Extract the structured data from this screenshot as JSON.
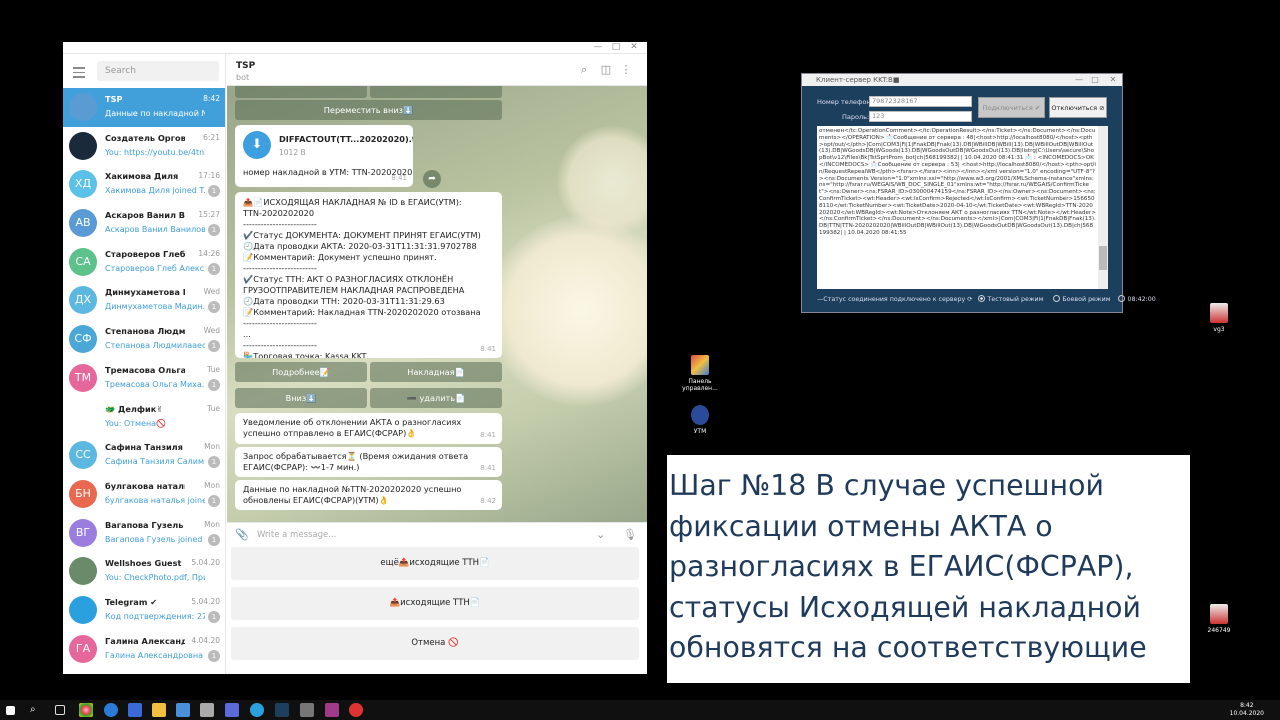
{
  "telegram": {
    "search_placeholder": "Search",
    "chats": [
      {
        "name": "TSP",
        "time": "8:42",
        "preview": "Данные по накладной №TTN-20...",
        "initials": "",
        "color": "#5a9bd4",
        "unread": ""
      },
      {
        "name": "Создатель Оргов",
        "time": "6:21",
        "preview": "You: https://youtu.be/4tnEC...",
        "initials": "",
        "color": "#1a2a3a",
        "unread": ""
      },
      {
        "name": "Хакимова Диля",
        "time": "17:16",
        "preview": "Хакимова Диля joined T...",
        "initials": "ХД",
        "color": "#5cc1e8",
        "unread": "1"
      },
      {
        "name": "Аскаров Ванил Вани...",
        "time": "15:27",
        "preview": "Аскаров Ванил Ванилов...",
        "initials": "АВ",
        "color": "#5b9bd5",
        "unread": "1"
      },
      {
        "name": "Староверов Глеб Ал...",
        "time": "14:26",
        "preview": "Староверов Глеб Алекс...",
        "initials": "СА",
        "color": "#5cc18a",
        "unread": "1"
      },
      {
        "name": "Динмухаметова Мад...",
        "time": "Wed",
        "preview": "Динмухаметова Мадин...",
        "initials": "ДХ",
        "color": "#5cb8e0",
        "unread": "1"
      },
      {
        "name": "Степанова Людмила...",
        "time": "Wed",
        "preview": "Степанова Людмилааес...",
        "initials": "СФ",
        "color": "#4aa8d8",
        "unread": "1"
      },
      {
        "name": "Тремасова Ольга Мих...",
        "time": "Tue",
        "preview": "Тремасова Ольга Миха...",
        "initials": "ТМ",
        "color": "#e6679a",
        "unread": "1"
      },
      {
        "name": "🐲 Делфик✌",
        "time": "Tue",
        "preview": "You: Отмена🚫",
        "initials": "",
        "color": "#ffffff",
        "unread": ""
      },
      {
        "name": "Сафина Танзиля Сали...",
        "time": "Mon",
        "preview": "Сафина Танзиля Салим...",
        "initials": "СС",
        "color": "#5cb8e0",
        "unread": "1"
      },
      {
        "name": "булгакова наталья",
        "time": "Mon",
        "preview": "булгакова наталья joine...",
        "initials": "БН",
        "color": "#e8694f",
        "unread": "1"
      },
      {
        "name": "Вагапова Гузель",
        "time": "Mon",
        "preview": "Вагапова Гузель joined ...",
        "initials": "ВГ",
        "color": "#9b7de0",
        "unread": "1"
      },
      {
        "name": "Wellshoes Guest",
        "time": "5.04.20",
        "preview": "You: CheckPhoto.pdf, Прим...",
        "initials": "",
        "color": "#6a8a6a",
        "unread": ""
      },
      {
        "name": "Telegram ✔",
        "time": "5.04.20",
        "preview": "Код подтверждения: 27...",
        "initials": "",
        "color": "#2aa1de",
        "unread": "1"
      },
      {
        "name": "Галина Александро...",
        "time": "4.04.20",
        "preview": "Галина Александровна j...",
        "initials": "ГА",
        "color": "#e6679a",
        "unread": "1"
      }
    ],
    "header": {
      "title": "TSP",
      "subtitle": "bot"
    },
    "kb_top": "Переместить вниз⬇️",
    "file": {
      "name": "DIFFACTOUT(TT...20202020).txt",
      "size": "1012 B",
      "caption": "номер накладной в УТМ: TTN-2020202020",
      "time": "8:41"
    },
    "big_msg": {
      "lines": [
        "📤📄ИСХОДЯЩАЯ НАКЛАДНАЯ № ID в ЕГАИС(УТМ):",
        "TTN-2020202020",
        "-------------------------",
        "✔️Статус ДОКУМЕНТА: ДОКУМЕНТ ПРИНЯТ ЕГАИС(УТМ)",
        "🕘Дата проводки АКТА: 2020-03-31T11:31:31.9702788",
        "📝Комментарий: Документ успешно принят.",
        "-------------------------",
        "✔️Статус ТТН: АКТ О РАЗНОГЛАСИЯХ ОТКЛОНЁН",
        "ГРУЗООТПРАВИТЕЛЕМ НАКЛАДНАЯ РАСПРОВЕДЕНА",
        "🕘Дата проводки ТТН: 2020-03-31T11:31:29.63",
        "📝Комментарий: Накладная TTN-2020202020 отозвана",
        "-------------------------",
        "...",
        "-------------------------",
        "🏪Торговая точка: Kassa KKT"
      ],
      "time": "8:41"
    },
    "kb_buttons": [
      "Подробнее📝",
      "Накладная📄",
      "Вниз⬇️",
      "➖ удалить📄"
    ],
    "msg_uved": {
      "text": "Уведомление об отклонении АКТА о разногласиях успешно отправлено в ЕГАИС(ФСРАР)👌",
      "time": "8:41"
    },
    "msg_zapros": {
      "text": "Запрос обрабатывается⏳ (Время ожидания ответа ЕГАИС(ФСРАР): 〰️1-7 мин.)",
      "time": "8:41"
    },
    "msg_dannye": {
      "text": "Данные по накладной №TTN-2020202020 успешно обновлены ЕГАИС(ФСРАР)(УТМ)👌",
      "time": "8:42"
    },
    "composer_placeholder": "Write a message...",
    "bot_buttons": [
      "ещё📤исходящие ТТН📄",
      "📤исходящие ТТН📄",
      "Отмена 🚫"
    ]
  },
  "client_server": {
    "title": "Клиент-сервер КKT:В■",
    "phone_label": "Номер телефона:",
    "phone_value": "79872328167",
    "password_label": "Пароль:",
    "password_value": "123",
    "connect_btn": "Подключиться ✔",
    "disconnect_btn": "Отключиться ⊘",
    "log": "отменен</tc:OperationComment></tc:OperationResult></ns:Ticket></ns:Document></ns:Documents></OPERATION> 📩Сообщение от сервера : 48|<host>http://localhost8080/</host><pth>opt/out/</pth>|Com|COM3|Fi|1|FnakDB|Fnak(13).DB|WBillDB|WBill(13).DB|WBillOutDB|WBillOut(13).DB|WGoodsDB|WGoods(13).DB|WGoodsOutDB|WGoodsOut(13).DB|listrg|C:\\Users\\secure\\ShopBot\\v12\\Files\\Bk|TstSprtProm_bot|ch|568199382| | 10.04.2020 08:41:31 📩 : <INCOMEDOCS>OK</INCOMEDOCS> 📩Сообщение от сервера : 53| <host>http://localhost8080/</host><pth>opt/in/RequestRepealWB</pth><fsrar></fsrar><inn></inn></xml version=\"1.0\" encoding=\"UTF-8\"?><ns:Documents Version=\"1.0\"xmlns:xsi=\"http://www.w3.org/2001/XMLSchema-instance\"xmlns:ns=\"http://fsrar.ru/WEGAIS/WB_DOC_SINGLE_01\"xmlns:wt=\"http://fsrar.ru/WEGAIS/ConfirmTicket\"><ns:Owner><ns:FSRAR_ID>030000474159</ns:FSRAR_ID></ns:Owner><ns:Document><ns:ConfirmTicket><wt:Header><wt:IsConfirm>Rejected</wt:IsConfirm><wt:TicketNumber>1566508110</wt:TicketNumber><wt:TicketDate>2020-04-10</wt:TicketDate><wt:WBRegId>TTN-2020202020</wt:WBRegId><wt:Note>Отклоняем АКТ о разногласиях TTN</wt:Note></wt:Header></ns:ConfirmTicket></ns:Document></ns:Documents></xml>|Com|COM3|Fi|1|FnakDB|Fnak(13).DB|TTN|TTN-2020202020|WBillOutDB|WBillOut(13).DB|WGoodsOutDB|WGoodsOut(13).DB|ch|568199382| | 10.04.2020 08:41:55",
    "status": "—Статус соединения подключено к серверу ⟳",
    "mode_test": "Тестовый режим",
    "mode_prod": "Боевой режим",
    "clock": "08:42:00"
  },
  "desktop_icons": [
    {
      "label": "Панель управлен...",
      "name": "control-panel"
    },
    {
      "label": "УТМ",
      "name": "utm"
    },
    {
      "label": "vg3",
      "name": "vg3"
    },
    {
      "label": "246749",
      "name": "246749"
    }
  ],
  "caption_lines": [
    "Шаг №18 В случае успешной",
    "фиксации отмены АКТА о",
    "разногласиях в ЕГАИС(ФСРАР),",
    "статусы Исходящей накладной",
    "обновятся на соответствующие"
  ],
  "taskbar": {
    "time": "8:42",
    "date": "10.04.2020"
  }
}
